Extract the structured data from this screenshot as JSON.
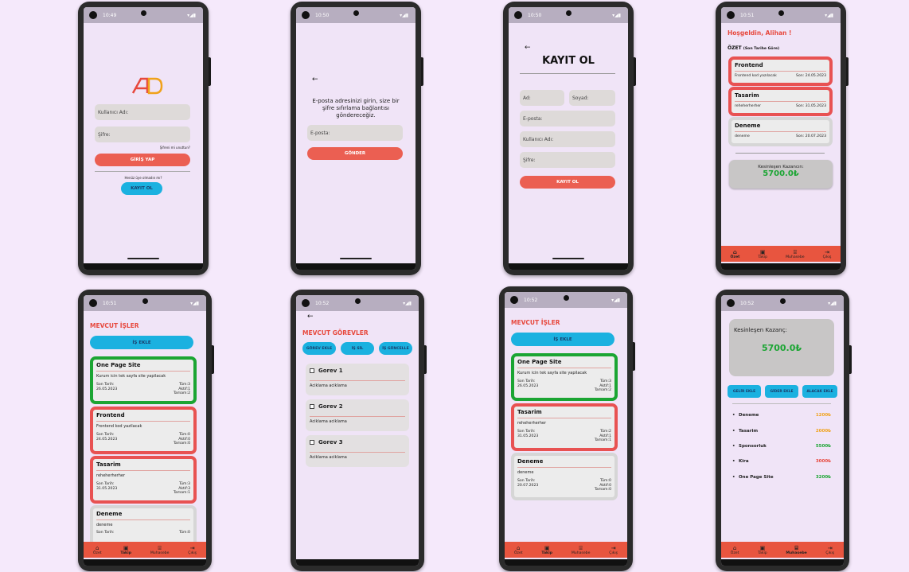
{
  "colors": {
    "accent": "#eb5f52",
    "blue": "#1bb1e0",
    "green": "#1ba533",
    "bg": "#f0e4f7",
    "tabbar": "#e8553f"
  },
  "login": {
    "time": "10:49",
    "logo": "AD",
    "username_placeholder": "Kullanıcı Adı:",
    "password_placeholder": "Şifre:",
    "forgot": "Şifreni mi unuttun?",
    "login_button": "GİRİŞ YAP",
    "no_account": "Henüz üye olmadın mı?",
    "register_button": "KAYIT OL"
  },
  "reset": {
    "time": "10:50",
    "message": "E-posta adresinizi girin, size bir şifre sıfırlama bağlantısı göndereceğiz.",
    "email_placeholder": "E-posta:",
    "send_button": "GÖNDER"
  },
  "register": {
    "time": "10:50",
    "title": "KAYIT OL",
    "name": "Ad:",
    "surname": "Soyad:",
    "email": "E-posta:",
    "username": "Kullanıcı Adı:",
    "password": "Şifre:",
    "button": "KAYIT OL"
  },
  "summary": {
    "time": "10:51",
    "greeting": "Hoşgeldin, Alihan !",
    "heading": "ÖZET",
    "heading_sub": "(Son Tarihe Göre)",
    "cards": [
      {
        "title": "Frontend",
        "desc": "Frontend kod yazılacak",
        "due": "Son: 24.05.2023"
      },
      {
        "title": "Tasarim",
        "desc": "reheherherher",
        "due": "Son: 31.05.2023"
      },
      {
        "title": "Deneme",
        "desc": "deneme",
        "due": "Son: 20.07.2023"
      }
    ],
    "earn_label": "Kesinleşen Kazancın:",
    "earn_value": "5700.0₺"
  },
  "tabs": [
    {
      "icon": "home-icon",
      "glyph": "⌂",
      "label": "Özet"
    },
    {
      "icon": "clipboard-icon",
      "glyph": "▣",
      "label": "Takip"
    },
    {
      "icon": "bank-icon",
      "glyph": "⌸",
      "label": "Muhasebe"
    },
    {
      "icon": "logout-icon",
      "glyph": "⇥",
      "label": "Çıkış"
    }
  ],
  "jobs": {
    "time": "10:51",
    "title": "MEVCUT İŞLER",
    "add_button": "İŞ EKLE",
    "cards": [
      {
        "title": "One Page Site",
        "desc": "Kurum icin tek sayfa site yapilacak",
        "due_label": "Son Tarih:",
        "due": "26.05.2023",
        "total": "Tüm:3",
        "active": "Aktif:1",
        "done": "Tamam:2"
      },
      {
        "title": "Frontend",
        "desc": "Frontend kod yazilacak",
        "due_label": "Son Tarih:",
        "due": "24.05.2023",
        "total": "Tüm:0",
        "active": "Aktif:0",
        "done": "Tamam:0"
      },
      {
        "title": "Tasarim",
        "desc": "reheherherher",
        "due_label": "Son Tarih:",
        "due": "31.05.2023",
        "total": "Tüm:3",
        "active": "Aktif:3",
        "done": "Tamam:1"
      },
      {
        "title": "Deneme",
        "desc": "deneme",
        "due_label": "Son Tarih:",
        "due": "20.07.2023",
        "total": "Tüm:0",
        "active": "Aktif:0",
        "done": "Tamam:0"
      }
    ]
  },
  "tasks": {
    "time": "10:52",
    "title": "MEVCUT GÖREVLER",
    "add": "GÖREV EKLE",
    "delete": "İŞ SİL",
    "update": "İŞ GÜNCELLE",
    "items": [
      {
        "title": "Gorev 1",
        "desc": "Aciklama aciklama"
      },
      {
        "title": "Gorev 2",
        "desc": "Aciklama aciklama"
      },
      {
        "title": "Gorev 3",
        "desc": "Aciklama aciklama"
      }
    ]
  },
  "jobs2": {
    "time": "10:52",
    "title": "MEVCUT İŞLER",
    "add_button": "İŞ EKLE",
    "cards": [
      {
        "title": "One Page Site",
        "desc": "Kurum icin tek sayfa site yapilacak",
        "due_label": "Son Tarih:",
        "due": "26.05.2023",
        "total": "Tüm:3",
        "active": "Aktif:1",
        "done": "Tamam:2"
      },
      {
        "title": "Tasarim",
        "desc": "reheherherher",
        "due_label": "Son Tarih:",
        "due": "31.05.2023",
        "total": "Tüm:2",
        "active": "Aktif:1",
        "done": "Tamam:1"
      },
      {
        "title": "Deneme",
        "desc": "deneme",
        "due_label": "Son Tarih:",
        "due": "20.07.2023",
        "total": "Tüm:0",
        "active": "Aktif:0",
        "done": "Tamam:0"
      }
    ]
  },
  "accounting": {
    "time": "10:52",
    "earn_label": "Kesinleşen Kazanç:",
    "earn_value": "5700.0₺",
    "income": "GELİR EKLE",
    "expense": "GİDER EKLE",
    "receivable": "ALACAK EKLE",
    "entries": [
      {
        "name": "Deneme",
        "amount": "1200₺",
        "color": "#f0a21a"
      },
      {
        "name": "Tasarim",
        "amount": "2000₺",
        "color": "#f0a21a"
      },
      {
        "name": "Sponsorluk",
        "amount": "5500₺",
        "color": "#1ba533"
      },
      {
        "name": "Kira",
        "amount": "3000₺",
        "color": "#e7483d"
      },
      {
        "name": "One Page Site",
        "amount": "3200₺",
        "color": "#1ba533"
      }
    ]
  }
}
